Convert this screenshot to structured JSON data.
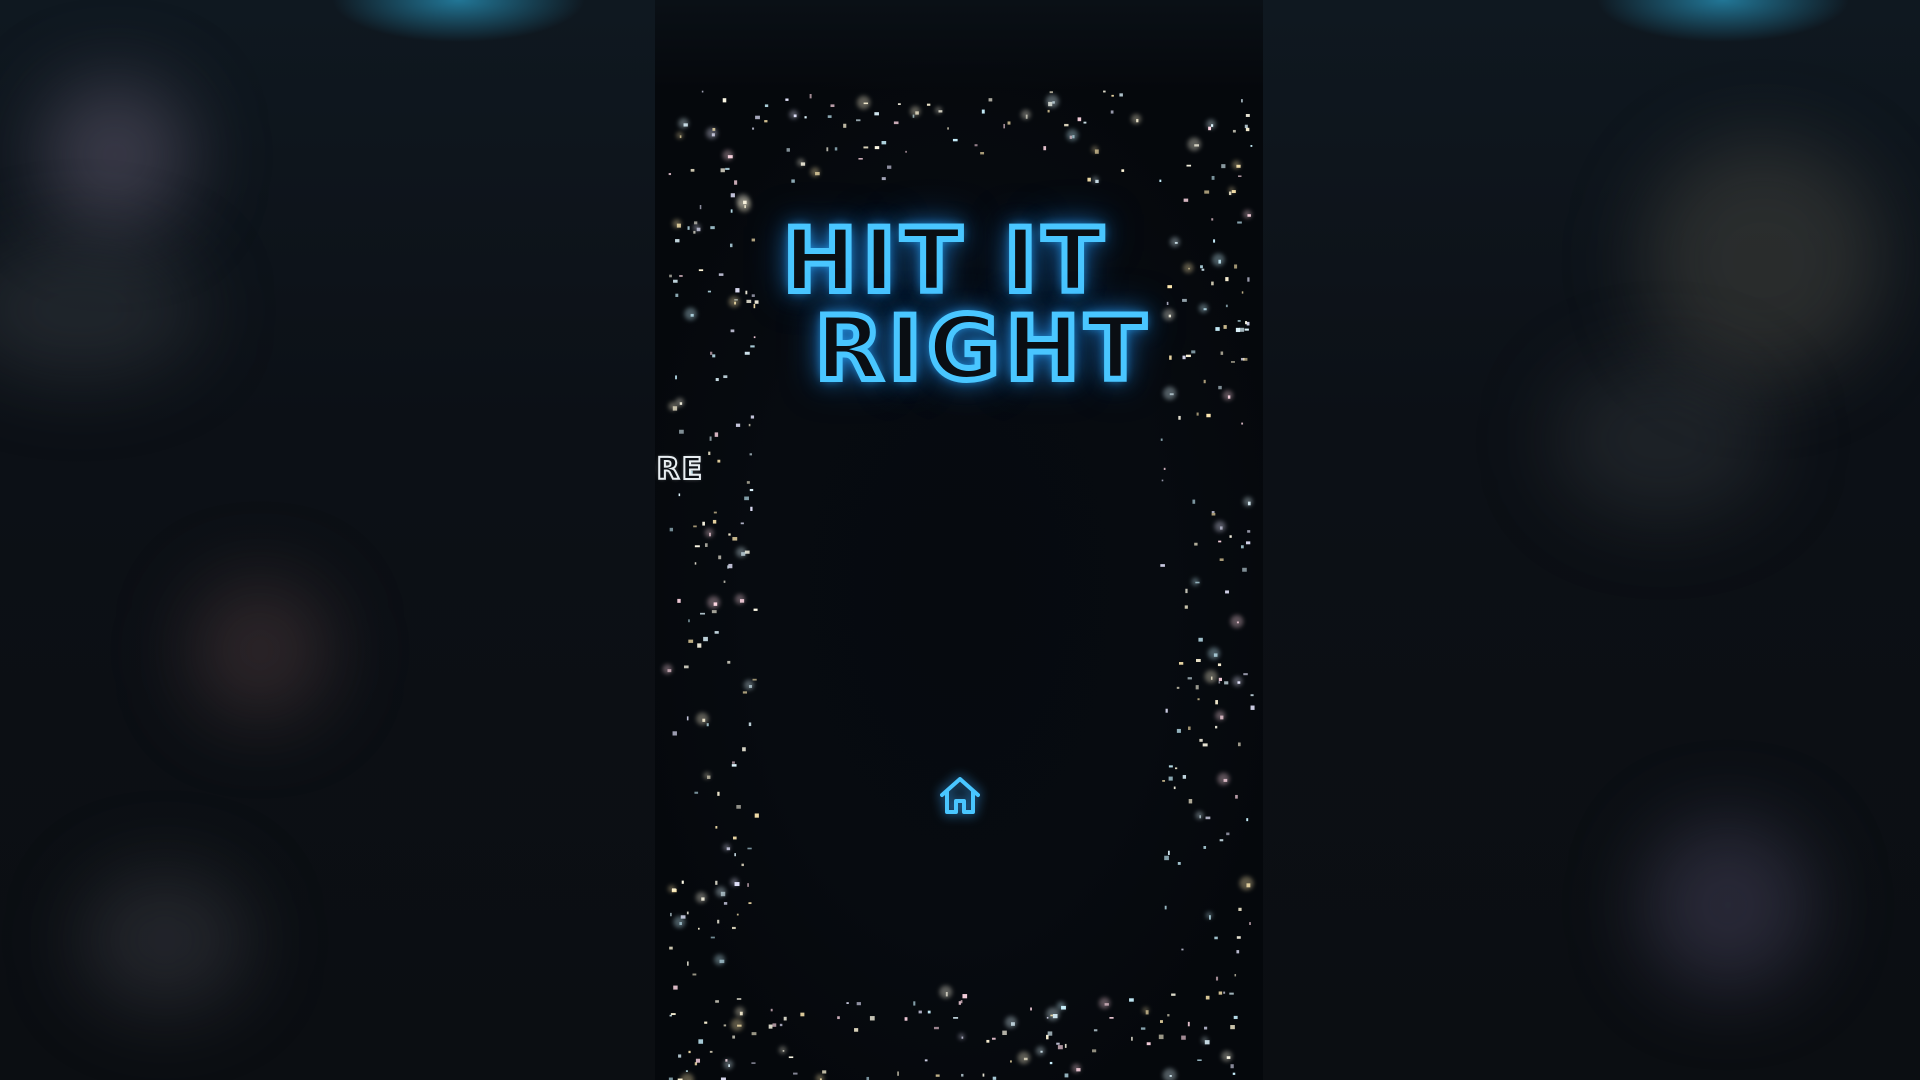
{
  "game": {
    "title_line_1": "HIT IT",
    "title_line_2": "RIGHT",
    "score_label": "ORE",
    "home_icon": "home-icon"
  },
  "colors": {
    "neon_blue": "#49c6ff",
    "background": "#0a0e13",
    "score_outline": "#e8eef2"
  }
}
